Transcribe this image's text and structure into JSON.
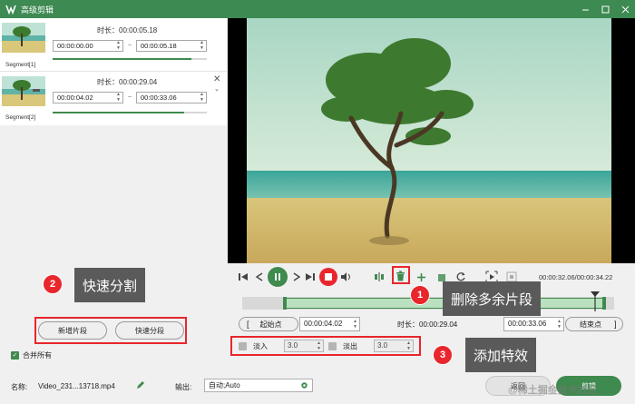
{
  "window": {
    "title": "高级剪辑"
  },
  "segments": [
    {
      "label": "Segment[1]",
      "duration": "时长：00:00:05.18",
      "start": "00:00:00.00",
      "end": "00:00:05.18",
      "progress": 0.9
    },
    {
      "label": "Segment[2]",
      "duration": "时长：00:00:29.04",
      "start": "00:00:04.02",
      "end": "00:00:33.06",
      "progress": 0.85
    }
  ],
  "segment_separator": "~",
  "left_buttons": {
    "add_segment": "新增片段",
    "quick_split": "快速分段"
  },
  "merge_all": {
    "label": "合并所有",
    "checked": true
  },
  "bottom": {
    "name_label": "名称:",
    "name_value": "Video_231...13718.mp4",
    "output_label": "输出:",
    "output_value": "自动;Auto",
    "back_button": "返回",
    "export_button": "剪辑"
  },
  "player": {
    "timecode": "00:00:32.06/00:00:34.22"
  },
  "timeline": {
    "range_start_fraction": 0.115,
    "range_end_fraction": 0.975,
    "playhead_fraction": 0.94
  },
  "trim": {
    "start_button": "起始点",
    "start_value": "00:00:04.02",
    "duration": "时长：00:00:29.04",
    "end_value": "00:00:33.06",
    "end_button": "结束点"
  },
  "fade": {
    "fade_in_label": "淡入",
    "fade_in_value": "3.0",
    "fade_out_label": "淡出",
    "fade_out_value": "3.0"
  },
  "annotations": [
    {
      "number": "1",
      "text": "删除多余片段"
    },
    {
      "number": "2",
      "text": "快速分割"
    },
    {
      "number": "3",
      "text": "添加特效"
    }
  ],
  "watermark": "@稀土掘金技术社区",
  "colors": {
    "accent": "#3f8a4e",
    "titlebar": "#3d8a52",
    "annotation_red": "#e8262c",
    "callout_bg": "#5a5a5a"
  },
  "icons": [
    "app-logo-icon",
    "minimize-icon",
    "maximize-icon",
    "close-icon",
    "prev-icon",
    "step-back-icon",
    "play-icon",
    "step-forward-icon",
    "next-icon",
    "stop-icon",
    "volume-icon",
    "split-icon",
    "delete-icon",
    "add-icon",
    "copy-icon",
    "rotate-icon",
    "snapshot-icon",
    "crop-icon",
    "edit-icon",
    "gear-icon"
  ]
}
